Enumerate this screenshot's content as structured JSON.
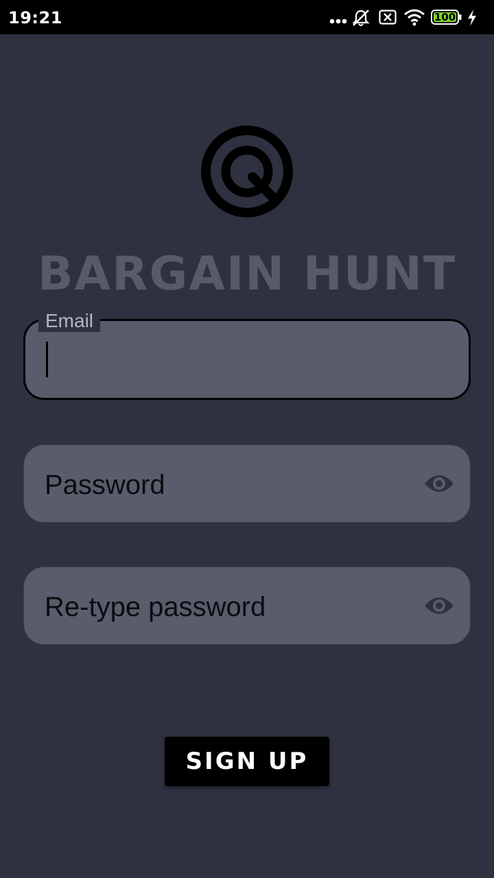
{
  "status_bar": {
    "time": "19:21",
    "battery": "100",
    "icons": [
      "more-dots-icon",
      "bell-off-icon",
      "no-sim-icon",
      "wifi-icon",
      "battery-icon",
      "charging-icon"
    ]
  },
  "app": {
    "title": "BARGAIN HUNT",
    "logo_icon": "target-q-logo"
  },
  "form": {
    "email": {
      "label": "Email",
      "value": ""
    },
    "password": {
      "label": "Password",
      "value": "",
      "icon": "eye-icon"
    },
    "retype_password": {
      "label": "Re-type password",
      "value": "",
      "icon": "eye-icon"
    },
    "submit_label": "SIGN UP"
  },
  "colors": {
    "background": "#2e3140",
    "field": "#595c6b",
    "title": "#575a69",
    "button": "#000000",
    "battery": "#7ed321"
  }
}
